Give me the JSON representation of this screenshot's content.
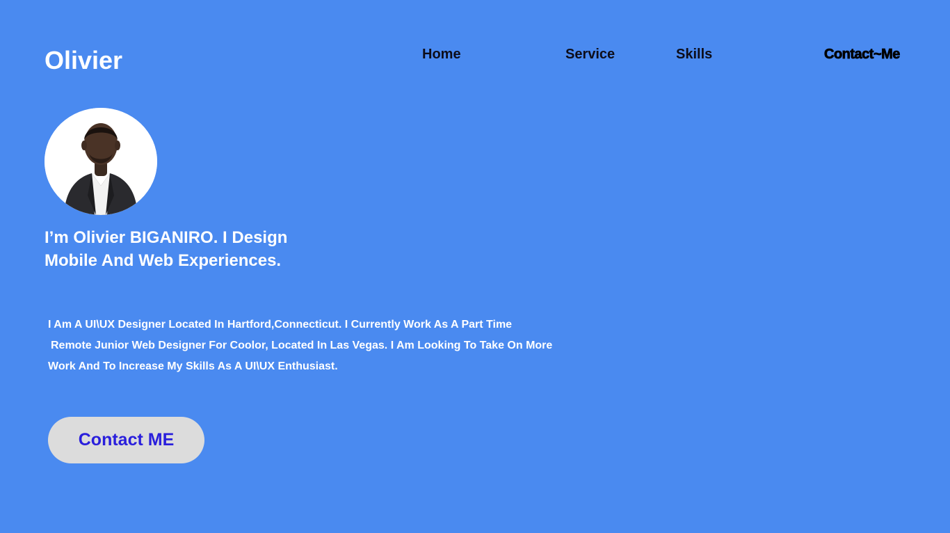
{
  "brand": {
    "name": "Olivier"
  },
  "nav": {
    "home": "Home",
    "service": "Service",
    "skills": "Skills",
    "contact": "Contact~Me"
  },
  "hero": {
    "headline_line1": "I’m Olivier BIGANIRO. I Design",
    "headline_line2": "Mobile And Web Experiences.",
    "bio_line1": "I Am A UI\\UX Designer Located In Hartford,Connecticut. I Currently Work As A Part Time",
    "bio_line2": "Remote Junior Web Designer For Coolor, Located In Las Vegas. I Am Looking To Take On More",
    "bio_line3": "Work And To Increase My Skills As A UI\\UX Enthusiast.",
    "cta_label": "Contact ME"
  },
  "colors": {
    "background": "#4a8af0",
    "cta_background": "#dcdcdc",
    "cta_text": "#2a1fdc"
  }
}
